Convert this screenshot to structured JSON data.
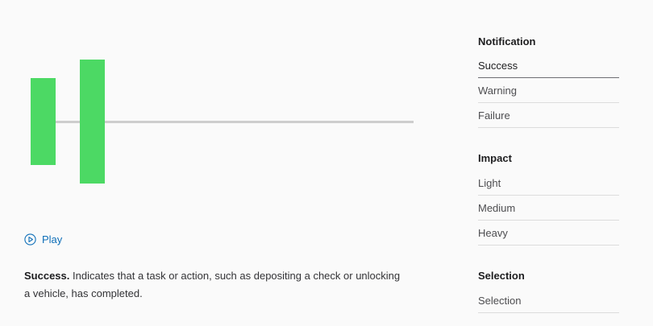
{
  "player": {
    "play_label": "Play"
  },
  "description": {
    "lead": "Success.",
    "body": "Indicates that a task or action, such as depositing a check or unlocking a vehicle, has completed."
  },
  "nav": {
    "notification": {
      "heading": "Notification",
      "items": [
        "Success",
        "Warning",
        "Failure"
      ],
      "selected": "Success"
    },
    "impact": {
      "heading": "Impact",
      "items": [
        "Light",
        "Medium",
        "Heavy"
      ]
    },
    "selection": {
      "heading": "Selection",
      "items": [
        "Selection"
      ]
    }
  },
  "colors": {
    "pulse": "#4cd964",
    "link": "#0f6fb8"
  }
}
